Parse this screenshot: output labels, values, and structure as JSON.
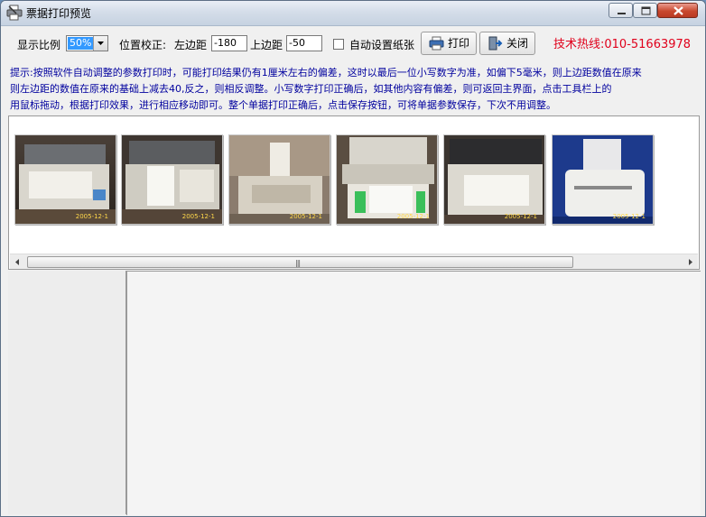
{
  "window": {
    "title": "票据打印预览",
    "app_icon": "printer-icon"
  },
  "toolbar": {
    "zoom_label": "显示比例",
    "zoom_value": "50%",
    "position_label": "位置校正:",
    "left_margin_label": "左边距",
    "left_margin_value": "-180",
    "top_margin_label": "上边距",
    "top_margin_value": "-50",
    "auto_paper_label": "自动设置纸张",
    "auto_paper_checked": false,
    "print_label": "打印",
    "print_icon": "printer-icon",
    "close_label": "关闭",
    "close_icon": "exit-door-icon",
    "hotline": "技术热线:010-51663978",
    "hotline_color": "#e0001b"
  },
  "hint": {
    "line1": "提示:按照软件自动调整的参数打印时，可能打印结果仍有1厘米左右的偏差，这时以最后一位小写数字为准，如偏下5毫米，则上边距数值在原来",
    "line2": "        则左边距的数值在原来的基础上减去40,反之，则相反调整。小写数字打印正确后，如其他内容有偏差，则可返回主界面，点击工具栏上的",
    "line3": "        用鼠标拖动，根据打印效果，进行相应移动即可。整个单据打印正确后，点击保存按钮，可将单据参数保存，下次不用调整。",
    "color": "#00009e"
  },
  "thumbnails": [
    {
      "date": "2005-12-1"
    },
    {
      "date": "2005-12-1"
    },
    {
      "date": "2005-12-1"
    },
    {
      "date": "2005-12-1"
    },
    {
      "date": "2005-12-1"
    },
    {
      "date": "2005-12-1"
    }
  ]
}
